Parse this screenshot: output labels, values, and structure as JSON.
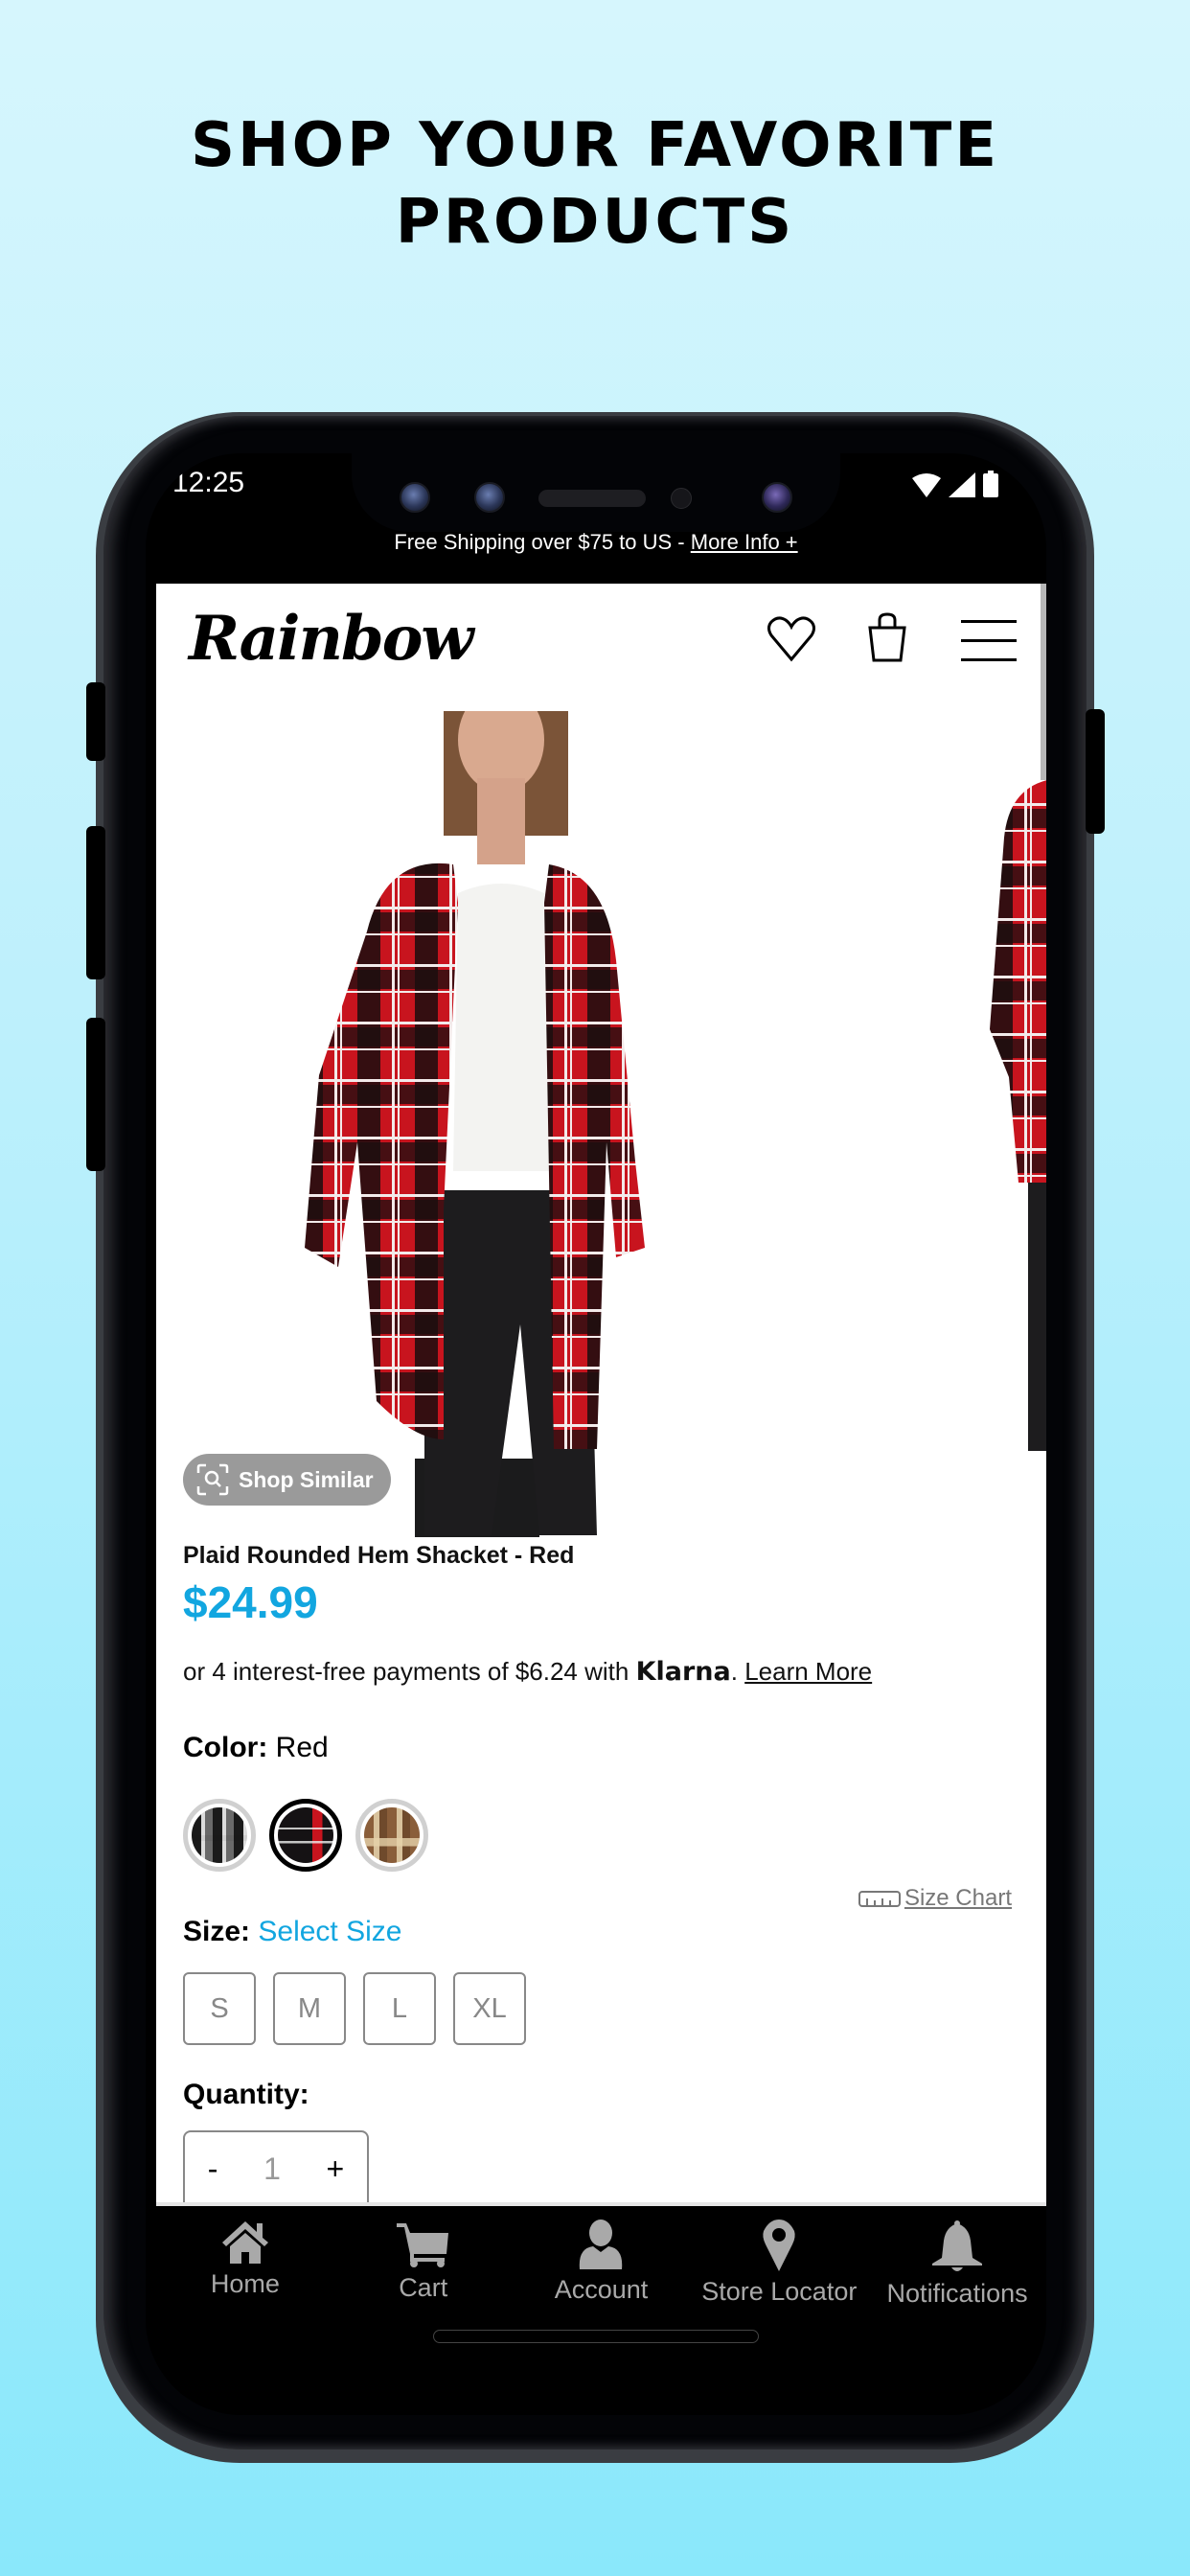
{
  "headline": {
    "line1": "SHOP YOUR FAVORITE",
    "line2": "PRODUCTS"
  },
  "status_bar": {
    "time": "12:25",
    "icons": [
      "wifi-icon",
      "cellular-signal-icon",
      "battery-icon"
    ]
  },
  "promo_banner": {
    "text": "Free Shipping over $75 to US - ",
    "link": "More Info +"
  },
  "header": {
    "logo": "Rainbow",
    "icons": [
      "heart-icon",
      "shopping-bag-icon",
      "hamburger-menu-icon"
    ]
  },
  "product": {
    "shop_similar_label": "Shop Similar",
    "title": "Plaid Rounded Hem Shacket - Red",
    "price": "$24.99",
    "price_color": "#12a6e0",
    "klarna": {
      "prefix": "or 4 interest-free payments of $6.24 with ",
      "brand": "Klarna",
      "suffix": ". ",
      "link": "Learn More"
    },
    "color": {
      "label": "Color:",
      "value": "Red",
      "swatches": [
        {
          "name": "Black/White plaid",
          "selected": false
        },
        {
          "name": "Red plaid",
          "selected": true
        },
        {
          "name": "Brown/Tan plaid",
          "selected": false
        }
      ]
    },
    "size_chart_label": "Size Chart",
    "size": {
      "label": "Size:",
      "value": "Select Size",
      "options": [
        "S",
        "M",
        "L",
        "XL"
      ]
    },
    "quantity": {
      "label": "Quantity:",
      "decrement": "-",
      "value": "1",
      "increment": "+"
    }
  },
  "bottom_nav": {
    "items": [
      {
        "label": "Home",
        "icon": "home-icon"
      },
      {
        "label": "Cart",
        "icon": "cart-icon"
      },
      {
        "label": "Account",
        "icon": "account-icon"
      },
      {
        "label": "Store Locator",
        "icon": "map-pin-icon"
      },
      {
        "label": "Notifications",
        "icon": "bell-icon"
      }
    ]
  }
}
